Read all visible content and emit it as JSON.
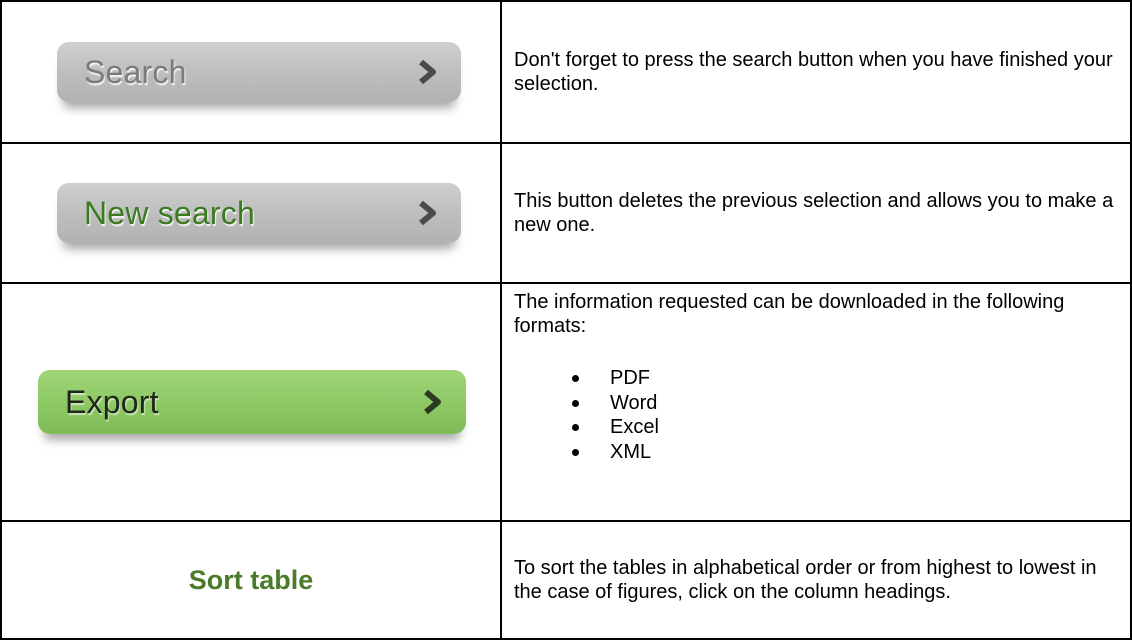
{
  "rows": [
    {
      "button_label": "Search",
      "description": "Don't forget to press the search button when you have finished your selection."
    },
    {
      "button_label": "New search",
      "description": "This button deletes the previous selection and allows you to make a new one."
    },
    {
      "button_label": "Export",
      "description": "The information requested can be downloaded in the following formats:",
      "formats": [
        "PDF",
        "Word",
        "Excel",
        "XML"
      ]
    },
    {
      "button_label": "Sort table",
      "description": "To sort the tables in alphabetical order or from highest to lowest in the case of figures, click on the column headings."
    }
  ],
  "icons": {
    "arrow": "chevron-right-icon"
  },
  "colors": {
    "gray_button": "#bdbdbd",
    "green_button": "#8dc865",
    "search_text": "#7b7b7b",
    "new_search_text": "#3c7a20",
    "sort_text": "#4a7a2a"
  }
}
